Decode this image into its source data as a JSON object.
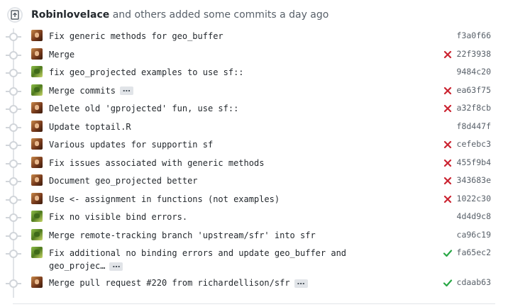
{
  "header": {
    "user": "Robinlovelace",
    "rest": " and others added some commits a day ago"
  },
  "colors": {
    "fail": "#cb2431",
    "success": "#28a745"
  },
  "commits": [
    {
      "author": "robin",
      "message": "Fix generic methods for geo_buffer",
      "status": "none",
      "sha": "f3a0f66"
    },
    {
      "author": "robin",
      "message": "Merge",
      "status": "fail",
      "sha": "22f3938"
    },
    {
      "author": "richard",
      "message": "fix geo_projected examples to use sf::",
      "status": "none",
      "sha": "9484c20"
    },
    {
      "author": "richard",
      "message": "Merge commits",
      "ellipsis": "…",
      "status": "fail",
      "sha": "ea63f75"
    },
    {
      "author": "robin",
      "message": "Delete old 'gprojected' fun, use sf::",
      "status": "fail",
      "sha": "a32f8cb"
    },
    {
      "author": "robin",
      "message": "Update toptail.R",
      "status": "none",
      "sha": "f8d447f"
    },
    {
      "author": "robin",
      "message": "Various updates for supportin sf",
      "status": "fail",
      "sha": "cefebc3"
    },
    {
      "author": "robin",
      "message": "Fix issues associated with generic methods",
      "status": "fail",
      "sha": "455f9b4"
    },
    {
      "author": "robin",
      "message": "Document geo_projected better",
      "status": "fail",
      "sha": "343683e"
    },
    {
      "author": "robin",
      "message": "Use <- assignment in functions (not examples)",
      "status": "fail",
      "sha": "1022c30"
    },
    {
      "author": "richard",
      "message": "Fix no visible bind errors.",
      "status": "none",
      "sha": "4d4d9c8"
    },
    {
      "author": "richard",
      "message": "Merge remote-tracking branch 'upstream/sfr' into sfr",
      "status": "none",
      "sha": "ca96c19"
    },
    {
      "author": "richard",
      "message": "Fix additional no binding errors and update geo_buffer and",
      "message2": "geo_projec…",
      "ellipsis": "…",
      "status": "success",
      "sha": "fa65ec2"
    },
    {
      "author": "robin",
      "message": "Merge pull request #220 from richardellison/sfr",
      "ellipsis": "…",
      "status": "success",
      "sha": "cdaab63"
    }
  ]
}
